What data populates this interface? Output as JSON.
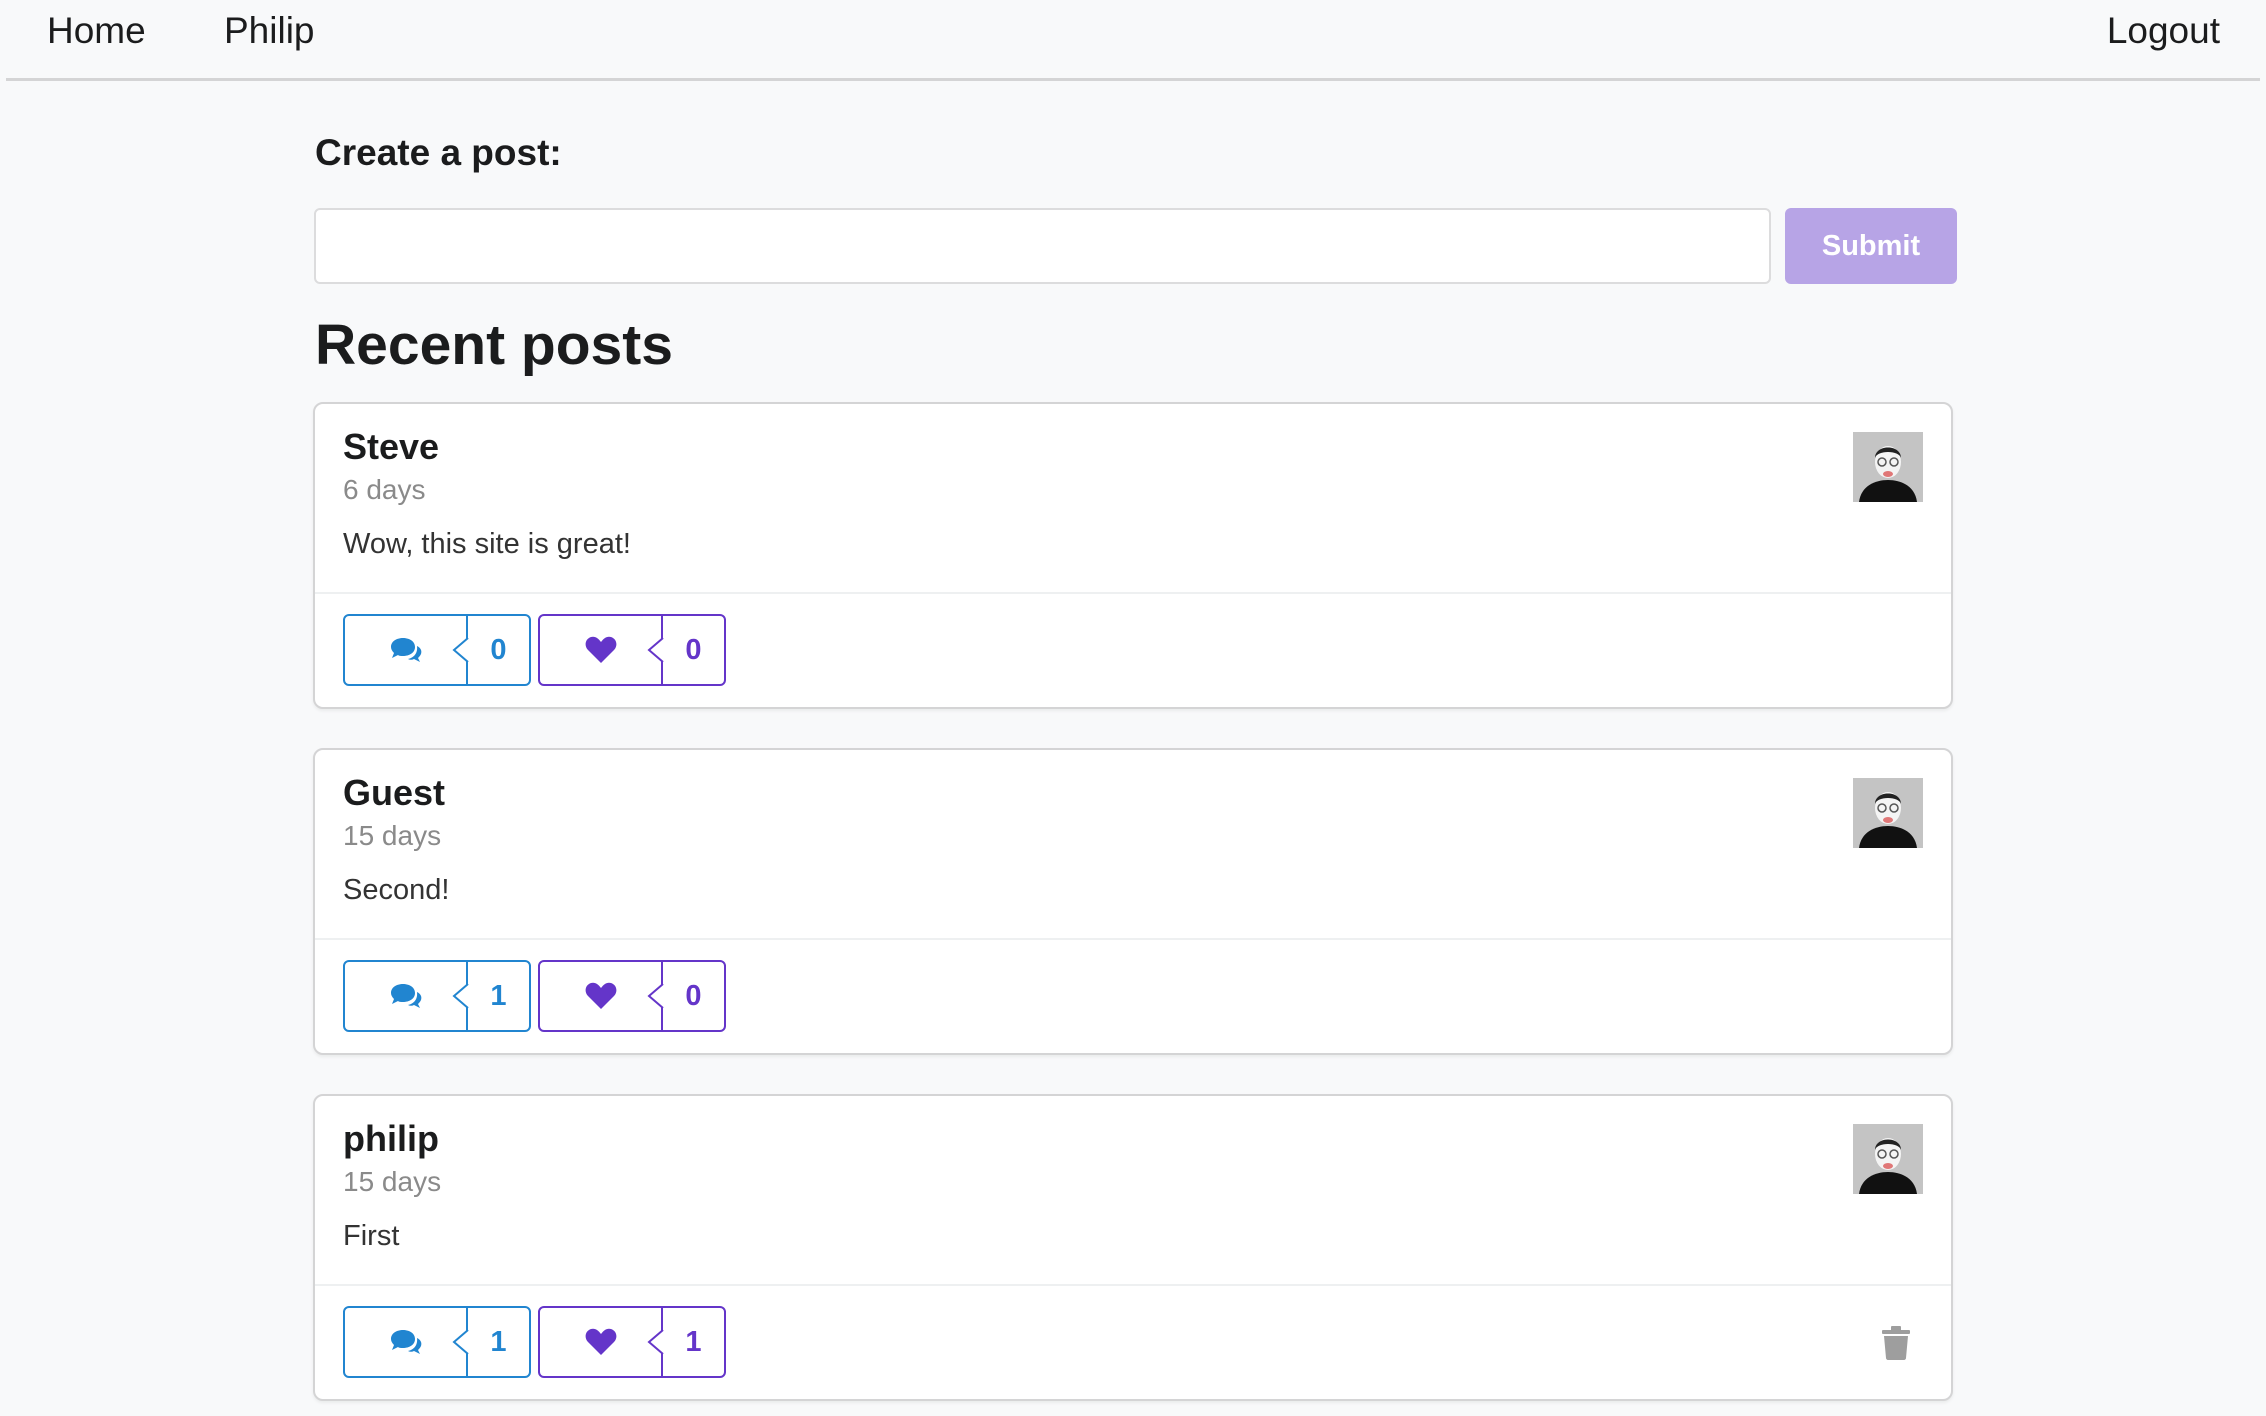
{
  "nav": {
    "home": "Home",
    "user": "Philip",
    "logout": "Logout"
  },
  "create": {
    "label": "Create a post:",
    "input_value": "",
    "submit_label": "Submit"
  },
  "recent_title": "Recent posts",
  "colors": {
    "comment_accent": "#2185d0",
    "like_accent": "#6435c9",
    "submit_bg": "#b7a4e6"
  },
  "posts": [
    {
      "author": "Steve",
      "time": "6 days",
      "text": "Wow, this site is great!",
      "comment_count": "0",
      "like_count": "0",
      "deletable": false
    },
    {
      "author": "Guest",
      "time": "15 days",
      "text": "Second!",
      "comment_count": "1",
      "like_count": "0",
      "deletable": false
    },
    {
      "author": "philip",
      "time": "15 days",
      "text": "First",
      "comment_count": "1",
      "like_count": "1",
      "deletable": true
    }
  ]
}
